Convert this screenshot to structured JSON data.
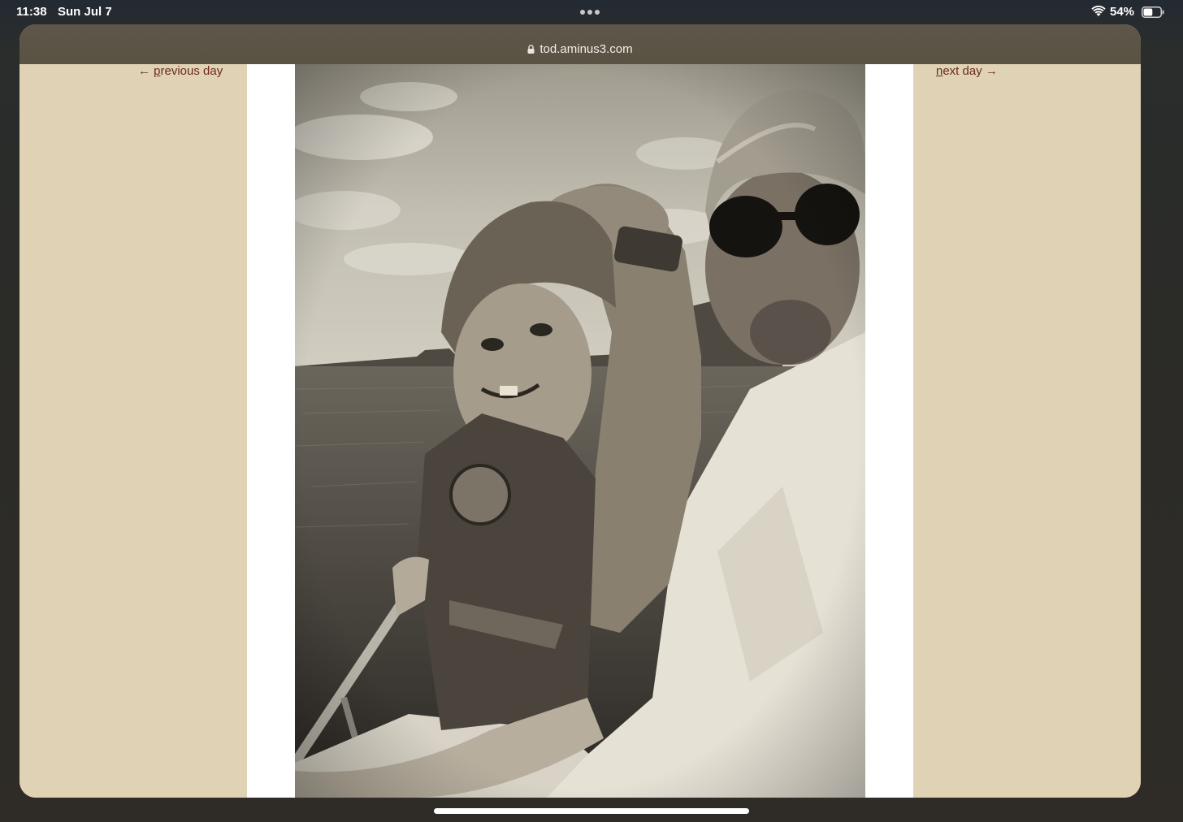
{
  "status_bar": {
    "time": "11:38",
    "date": "Sun Jul 7",
    "battery_percent": "54%",
    "battery_level": 0.54,
    "wifi": "wifi-icon"
  },
  "browser": {
    "url": "tod.aminus3.com",
    "lock": "lock-icon"
  },
  "page": {
    "prev_link": {
      "arrow": "← ",
      "underlined": "p",
      "rest": "revious day"
    },
    "next_link": {
      "underlined": "n",
      "rest": "ext day",
      "arrow": " →"
    },
    "photo_alt": "",
    "background_color": "#e0d3b5",
    "link_color": "#6e2a1c"
  }
}
